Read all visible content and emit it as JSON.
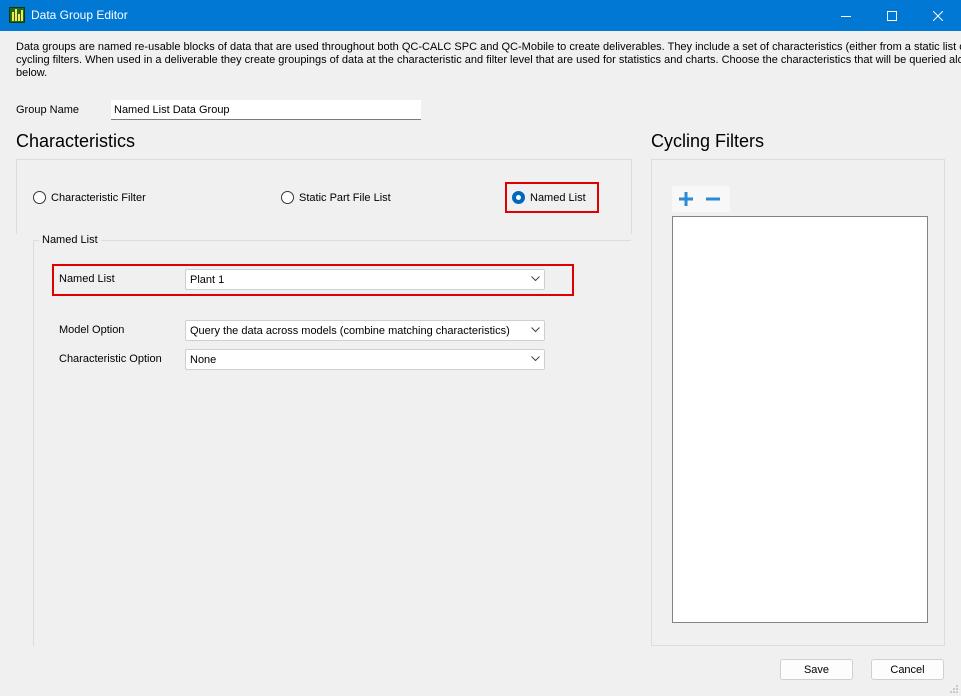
{
  "window": {
    "title": "Data Group Editor",
    "accent": "#0078d4"
  },
  "description": {
    "line1": "Data groups are named re-usable blocks of data that are used throughout both QC-CALC SPC and QC-Mobile to create deliverables. They include a set of characteristics (either from a static list of part fi",
    "line2": "cycling filters. When used in a deliverable they create groupings of data at the characteristic and filter level that are used for statistics and charts. Choose the characteristics that will be queried along wit",
    "line3": "below."
  },
  "group_name": {
    "label": "Group Name",
    "value": "Named List Data Group"
  },
  "characteristics": {
    "heading": "Characteristics",
    "options": [
      {
        "label": "Characteristic Filter",
        "checked": false
      },
      {
        "label": "Static Part File List",
        "checked": false
      },
      {
        "label": "Named List",
        "checked": true
      }
    ],
    "named_list_group": {
      "title": "Named List",
      "named_list_label": "Named List",
      "named_list_value": "Plant 1",
      "model_option_label": "Model Option",
      "model_option_value": "Query the data across models (combine matching characteristics)",
      "characteristic_option_label": "Characteristic Option",
      "characteristic_option_value": "None"
    }
  },
  "cycling_filters": {
    "heading": "Cycling Filters",
    "add_icon": "plus-icon",
    "remove_icon": "minus-icon"
  },
  "buttons": {
    "save": "Save",
    "cancel": "Cancel"
  },
  "colors": {
    "highlight": "#e00000",
    "radio_checked": "#0067c0",
    "tool_icon": "#2a8ad4"
  }
}
